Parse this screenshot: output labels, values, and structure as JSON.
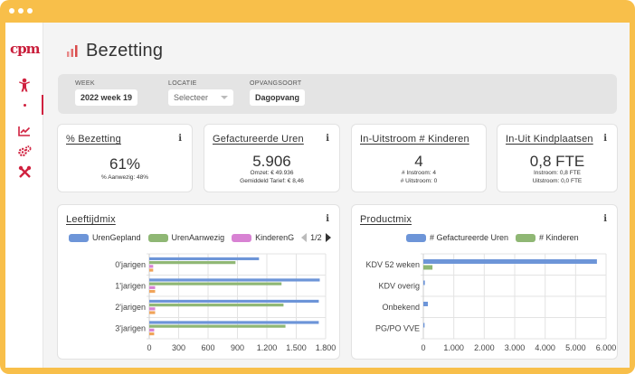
{
  "window": {
    "controls": [
      "dot",
      "dot",
      "dot"
    ]
  },
  "sidebar": {
    "logo": "cpm",
    "items": [
      {
        "icon": "person-icon",
        "active": false
      },
      {
        "icon": "dot-icon",
        "active": true
      },
      {
        "icon": "line-chart-icon",
        "active": false
      },
      {
        "icon": "gears-icon",
        "active": false
      },
      {
        "icon": "tools-icon",
        "active": false
      }
    ],
    "accent_color": "#d0213f"
  },
  "page": {
    "title": "Bezetting",
    "title_icon": "bar-chart-icon"
  },
  "filters": {
    "week": {
      "label": "WEEK",
      "value": "2022 week 19"
    },
    "locatie": {
      "label": "LOCATIE",
      "value": "Selecteer"
    },
    "opvangsoort": {
      "label": "OPVANGSOORT",
      "value": "Dagopvang"
    }
  },
  "kpis": [
    {
      "title": "% Bezetting",
      "value": "61%",
      "sub": [
        "% Aanwezig: 48%"
      ]
    },
    {
      "title": "Gefactureerde Uren",
      "value": "5.906",
      "sub": [
        "Omzet: € 49.936",
        "Gemiddeld Tarief: € 8,46"
      ]
    },
    {
      "title": "In-Uitstroom # Kinderen",
      "value": "4",
      "sub": [
        "# Instroom: 4",
        "# Uitstroom: 0"
      ]
    },
    {
      "title": "In-Uit Kindplaatsen",
      "value": "0,8 FTE",
      "sub": [
        "Instroom: 0,8 FTE",
        "Uitstroom: 0,0 FTE"
      ]
    }
  ],
  "info_symbol": "i",
  "chart_data": [
    {
      "type": "bar",
      "orientation": "horizontal",
      "title": "Leeftijdmix",
      "categories": [
        "0'jarigen",
        "1'jarigen",
        "2'jarigen",
        "3'jarigen"
      ],
      "series": [
        {
          "name": "UrenGepland",
          "color": "#6d95d8",
          "values": [
            1120,
            1740,
            1730,
            1730
          ]
        },
        {
          "name": "UrenAanwezig",
          "color": "#8fb774",
          "values": [
            880,
            1350,
            1370,
            1390
          ]
        },
        {
          "name": "KinderenG",
          "color": "#d882d3",
          "values": [
            40,
            60,
            60,
            50
          ]
        },
        {
          "name": "",
          "color": "#f0a45a",
          "values": [
            40,
            60,
            60,
            50
          ]
        }
      ],
      "xlim": [
        0,
        1800
      ],
      "xticks": [
        "0",
        "300",
        "600",
        "900",
        "1.200",
        "1.500",
        "1.800"
      ],
      "legend_pager": "1/2",
      "grid": true
    },
    {
      "type": "bar",
      "orientation": "horizontal",
      "title": "Productmix",
      "categories": [
        "KDV 52 weken",
        "KDV overig",
        "Onbekend",
        "PG/PO VVE"
      ],
      "series": [
        {
          "name": "# Gefactureerde Uren",
          "color": "#6d95d8",
          "values": [
            5700,
            50,
            150,
            40
          ]
        },
        {
          "name": "# Kinderen",
          "color": "#8fb774",
          "values": [
            300,
            0,
            0,
            0
          ]
        }
      ],
      "xlim": [
        0,
        6000
      ],
      "xticks": [
        "0",
        "1.000",
        "2.000",
        "3.000",
        "4.000",
        "5.000",
        "6.000"
      ],
      "grid": true
    }
  ]
}
